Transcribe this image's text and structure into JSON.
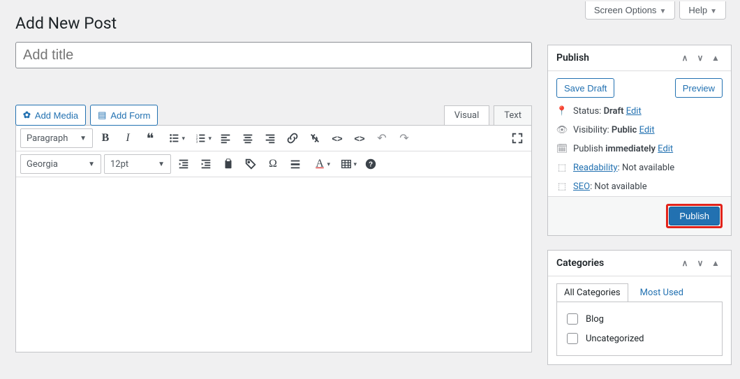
{
  "screen_meta": {
    "screen_options": "Screen Options",
    "help": "Help"
  },
  "page_title": "Add New Post",
  "title_placeholder": "Add title",
  "media": {
    "add_media": "Add Media",
    "add_form": "Add Form"
  },
  "editor_tabs": {
    "visual": "Visual",
    "text": "Text"
  },
  "toolbar": {
    "paragraph": "Paragraph",
    "font_family": "Georgia",
    "font_size": "12pt"
  },
  "publish": {
    "title": "Publish",
    "save_draft": "Save Draft",
    "preview": "Preview",
    "status_label": "Status:",
    "status_value": "Draft",
    "visibility_label": "Visibility:",
    "visibility_value": "Public",
    "schedule_label": "Publish",
    "schedule_value": "immediately",
    "edit": "Edit",
    "readability_label": "Readability",
    "seo_label": "SEO",
    "not_available": ": Not available",
    "publish_btn": "Publish"
  },
  "categories_box": {
    "title": "Categories",
    "all_tab": "All Categories",
    "most_used_tab": "Most Used",
    "items": [
      "Blog",
      "Uncategorized"
    ]
  }
}
